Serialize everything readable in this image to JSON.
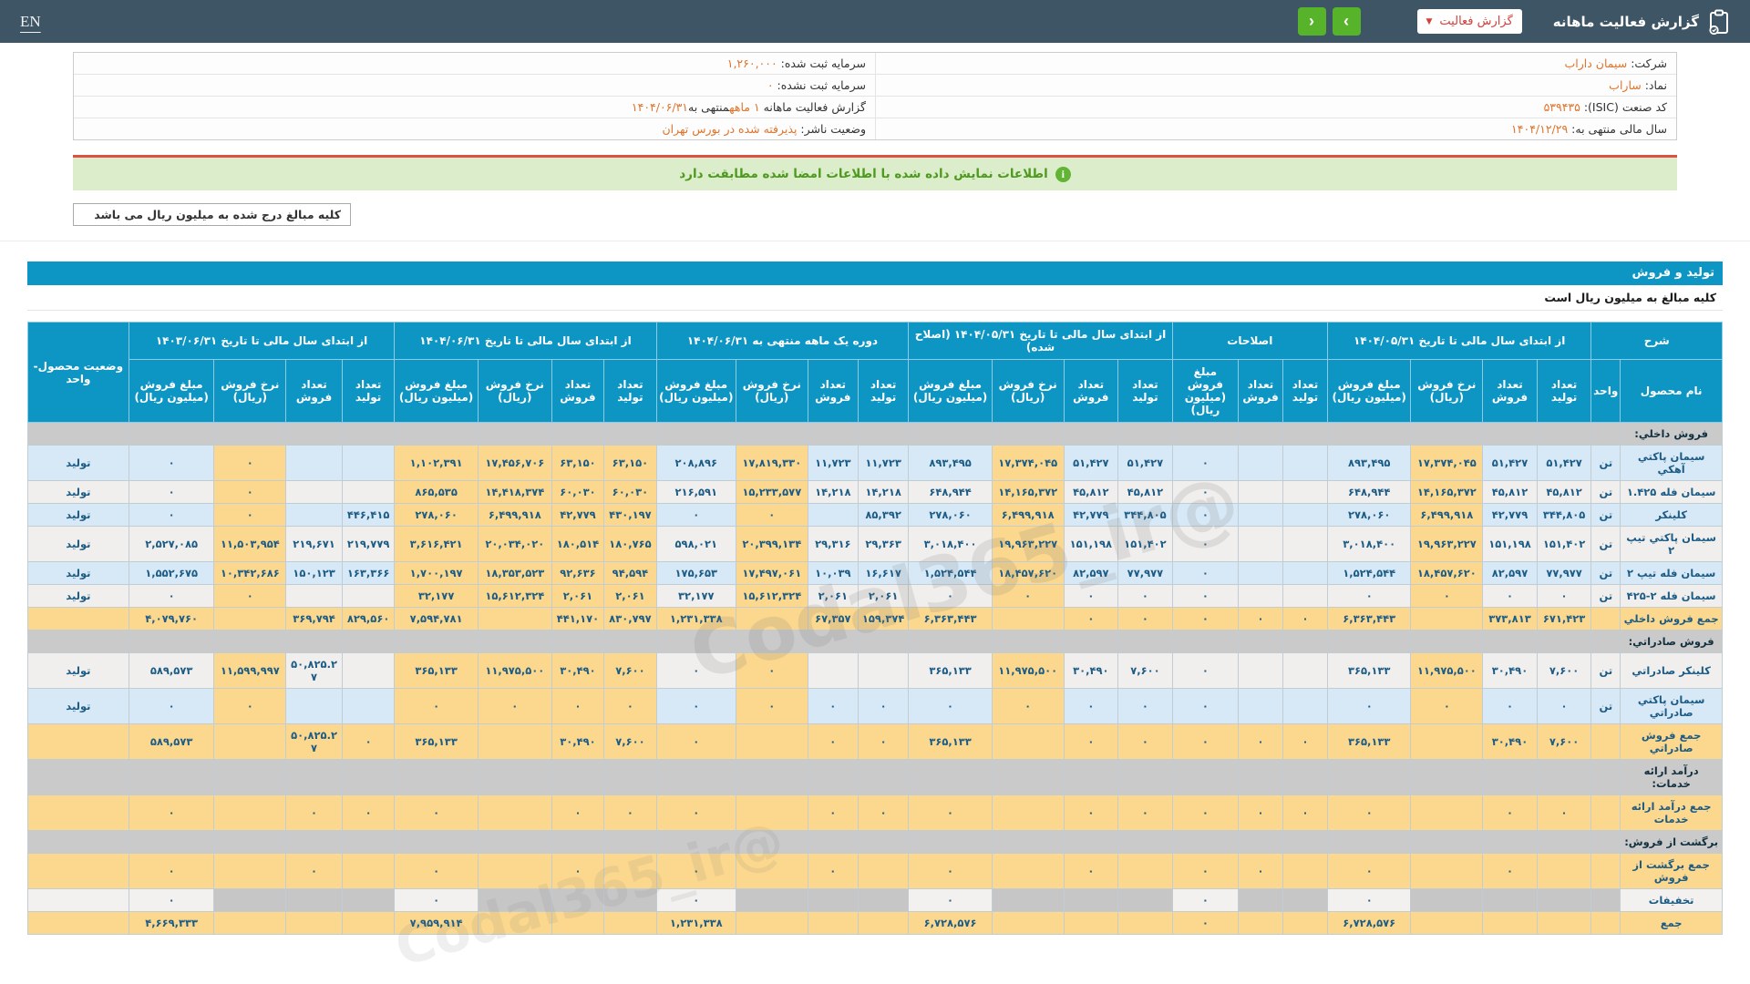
{
  "topbar": {
    "title": "گزارش فعالیت ماهانه",
    "dropdown_label": "گزارش فعالیت",
    "dropdown_caret": "▼",
    "nav_forward_glyph": "›",
    "nav_back_glyph": "‹",
    "lang": "EN"
  },
  "colors": {
    "topbar_bg": "#3d5565",
    "accent_blue": "#0d95c4",
    "highlight_yellow": "#fbd88d",
    "row_blue": "#d7e9f6",
    "row_gray": "#f0efed",
    "section_gray": "#cacaca",
    "value_orange": "#e0742c",
    "green_button": "#57b42a",
    "notice_bg": "#dcedcb",
    "notice_text": "#4e9a1e",
    "red_divider": "#dd5144",
    "number_blue": "#1d5c86"
  },
  "info": {
    "rows": [
      {
        "right": {
          "label": "شرکت:",
          "parts": [
            [
              "سیمان داراب",
              true
            ]
          ]
        },
        "left": {
          "label": "سرمایه ثبت شده:",
          "parts": [
            [
              "۱,۲۶۰,۰۰۰",
              true
            ]
          ]
        }
      },
      {
        "right": {
          "label": "نماد:",
          "parts": [
            [
              "ساراب",
              true
            ]
          ]
        },
        "left": {
          "label": "سرمایه ثبت نشده:",
          "parts": [
            [
              "۰",
              true
            ]
          ]
        }
      },
      {
        "right": {
          "label": "کد صنعت (ISIC):",
          "parts": [
            [
              "۵۳۹۴۳۵",
              true
            ]
          ]
        },
        "left": {
          "label": "گزارش فعالیت ماهانه",
          "parts": [
            [
              "۱ ماهه",
              true
            ],
            [
              "منتهی به",
              false
            ],
            [
              "۱۴۰۴/۰۶/۳۱",
              true
            ]
          ]
        }
      },
      {
        "right": {
          "label": "سال مالی منتهی به:",
          "parts": [
            [
              "۱۴۰۴/۱۲/۲۹",
              true
            ]
          ]
        },
        "left": {
          "label": "وضعیت ناشر:",
          "parts": [
            [
              "پذیرفته شده در بورس تهران",
              true
            ]
          ]
        }
      }
    ]
  },
  "notice": {
    "icon_glyph": "i",
    "text": "اطلاعات نمایش داده شده با اطلاعات امضا شده مطابقت دارد"
  },
  "amounts_box": {
    "text": "کلیه مبالغ درج شده به میلیون ریال می باشد"
  },
  "section_bar": {
    "title": "تولید و فروش"
  },
  "table_note": {
    "text": "کلیه مبالغ به میلیون ریال است"
  },
  "watermark": {
    "text": "@Codal365_ir"
  },
  "table": {
    "desc_header": "شرح",
    "name_header": "نام محصول",
    "unit_header": "واحد",
    "status_header": "وضعیت محصول-واحد",
    "subcols4": [
      "تعداد تولید",
      "تعداد فروش",
      "نرخ فروش (ریال)",
      "مبلغ فروش (میلیون ریال)"
    ],
    "subcols3": [
      "تعداد تولید",
      "تعداد فروش",
      "مبلغ فروش (میلیون ریال)"
    ],
    "groups": [
      {
        "key": "A",
        "label": "از ابتدای سال مالی تا تاریخ ۱۴۰۴/۰۵/۳۱",
        "cols": 4
      },
      {
        "key": "B",
        "label": "اصلاحات",
        "cols": 3
      },
      {
        "key": "C",
        "label": "از ابتدای سال مالی تا تاریخ ۱۴۰۴/۰۵/۳۱ (اصلاح شده)",
        "cols": 4
      },
      {
        "key": "D",
        "label": "دوره یک ماهه منتهی به ۱۴۰۴/۰۶/۳۱",
        "cols": 4
      },
      {
        "key": "E",
        "label": "از ابتدای سال مالی تا تاریخ ۱۴۰۴/۰۶/۳۱",
        "cols": 4
      },
      {
        "key": "F",
        "label": "از ابتدای سال مالی تا تاریخ ۱۴۰۳/۰۶/۳۱",
        "cols": 4
      }
    ],
    "rows": [
      {
        "type": "section",
        "name": "فروش داخلي:"
      },
      {
        "type": "data",
        "tone": "blue",
        "name": "سیمان پاکتي آهکي",
        "unit": "تن",
        "status": "تولید",
        "A": [
          "۵۱,۴۲۷",
          "۵۱,۴۲۷",
          "۱۷,۳۷۴,۰۴۵",
          "۸۹۳,۴۹۵"
        ],
        "B": [
          "",
          "",
          "۰"
        ],
        "C": [
          "۵۱,۴۲۷",
          "۵۱,۴۲۷",
          "۱۷,۳۷۴,۰۴۵",
          "۸۹۳,۴۹۵"
        ],
        "D": [
          "۱۱,۷۲۳",
          "۱۱,۷۲۳",
          "۱۷,۸۱۹,۳۳۰",
          "۲۰۸,۸۹۶"
        ],
        "E": [
          "۶۳,۱۵۰",
          "۶۳,۱۵۰",
          "۱۷,۴۵۶,۷۰۶",
          "۱,۱۰۲,۳۹۱"
        ],
        "F": [
          "",
          "",
          "۰",
          "۰"
        ]
      },
      {
        "type": "data",
        "tone": "gray",
        "name": "سیمان فله ۱.۴۲۵",
        "unit": "تن",
        "status": "تولید",
        "A": [
          "۴۵,۸۱۲",
          "۴۵,۸۱۲",
          "۱۴,۱۶۵,۳۷۲",
          "۶۴۸,۹۴۴"
        ],
        "B": [
          "",
          "",
          "۰"
        ],
        "C": [
          "۴۵,۸۱۲",
          "۴۵,۸۱۲",
          "۱۴,۱۶۵,۳۷۲",
          "۶۴۸,۹۴۴"
        ],
        "D": [
          "۱۴,۲۱۸",
          "۱۴,۲۱۸",
          "۱۵,۲۳۳,۵۷۷",
          "۲۱۶,۵۹۱"
        ],
        "E": [
          "۶۰,۰۳۰",
          "۶۰,۰۳۰",
          "۱۴,۴۱۸,۳۷۴",
          "۸۶۵,۵۳۵"
        ],
        "F": [
          "",
          "",
          "۰",
          "۰"
        ]
      },
      {
        "type": "data",
        "tone": "blue",
        "name": "کلینکر",
        "unit": "تن",
        "status": "تولید",
        "A": [
          "۳۴۴,۸۰۵",
          "۴۲,۷۷۹",
          "۶,۴۹۹,۹۱۸",
          "۲۷۸,۰۶۰"
        ],
        "B": [
          "",
          "",
          "۰"
        ],
        "C": [
          "۳۴۴,۸۰۵",
          "۴۲,۷۷۹",
          "۶,۴۹۹,۹۱۸",
          "۲۷۸,۰۶۰"
        ],
        "D": [
          "۸۵,۳۹۲",
          "",
          "۰",
          "۰"
        ],
        "E": [
          "۴۳۰,۱۹۷",
          "۴۲,۷۷۹",
          "۶,۴۹۹,۹۱۸",
          "۲۷۸,۰۶۰"
        ],
        "F": [
          "۴۴۶,۴۱۵",
          "",
          "۰",
          "۰"
        ]
      },
      {
        "type": "data",
        "tone": "gray",
        "name": "سیمان پاکتي تیپ ۲",
        "unit": "تن",
        "status": "تولید",
        "A": [
          "۱۵۱,۴۰۲",
          "۱۵۱,۱۹۸",
          "۱۹,۹۶۳,۲۲۷",
          "۳,۰۱۸,۴۰۰"
        ],
        "B": [
          "",
          "",
          "۰"
        ],
        "C": [
          "۱۵۱,۴۰۲",
          "۱۵۱,۱۹۸",
          "۱۹,۹۶۳,۲۲۷",
          "۳,۰۱۸,۴۰۰"
        ],
        "D": [
          "۲۹,۳۶۳",
          "۲۹,۳۱۶",
          "۲۰,۳۹۹,۱۳۴",
          "۵۹۸,۰۲۱"
        ],
        "E": [
          "۱۸۰,۷۶۵",
          "۱۸۰,۵۱۴",
          "۲۰,۰۳۴,۰۲۰",
          "۳,۶۱۶,۴۲۱"
        ],
        "F": [
          "۲۱۹,۷۷۹",
          "۲۱۹,۶۷۱",
          "۱۱,۵۰۳,۹۵۴",
          "۲,۵۲۷,۰۸۵"
        ]
      },
      {
        "type": "data",
        "tone": "blue",
        "name": "سیمان فله تیپ ۲",
        "unit": "تن",
        "status": "تولید",
        "A": [
          "۷۷,۹۷۷",
          "۸۲,۵۹۷",
          "۱۸,۴۵۷,۶۲۰",
          "۱,۵۲۴,۵۴۴"
        ],
        "B": [
          "",
          "",
          "۰"
        ],
        "C": [
          "۷۷,۹۷۷",
          "۸۲,۵۹۷",
          "۱۸,۴۵۷,۶۲۰",
          "۱,۵۲۴,۵۴۴"
        ],
        "D": [
          "۱۶,۶۱۷",
          "۱۰,۰۳۹",
          "۱۷,۴۹۷,۰۶۱",
          "۱۷۵,۶۵۳"
        ],
        "E": [
          "۹۴,۵۹۴",
          "۹۲,۶۳۶",
          "۱۸,۳۵۳,۵۲۳",
          "۱,۷۰۰,۱۹۷"
        ],
        "F": [
          "۱۶۳,۳۶۶",
          "۱۵۰,۱۲۳",
          "۱۰,۳۴۲,۶۸۶",
          "۱,۵۵۲,۶۷۵"
        ]
      },
      {
        "type": "data",
        "tone": "gray",
        "name": "سیمان فله ۲-۴۲۵",
        "unit": "تن",
        "status": "تولید",
        "A": [
          "۰",
          "۰",
          "۰",
          "۰"
        ],
        "B": [
          "",
          "",
          "۰"
        ],
        "C": [
          "۰",
          "۰",
          "۰",
          "۰"
        ],
        "D": [
          "۲,۰۶۱",
          "۲,۰۶۱",
          "۱۵,۶۱۲,۳۲۴",
          "۳۲,۱۷۷"
        ],
        "E": [
          "۲,۰۶۱",
          "۲,۰۶۱",
          "۱۵,۶۱۲,۳۲۴",
          "۳۲,۱۷۷"
        ],
        "F": [
          "",
          "",
          "۰",
          "۰"
        ]
      },
      {
        "type": "total",
        "name": "جمع فروش داخلي",
        "A": [
          "۶۷۱,۴۲۳",
          "۳۷۳,۸۱۳",
          "",
          "۶,۳۶۳,۴۴۳"
        ],
        "B": [
          "۰",
          "۰",
          "۰"
        ],
        "C": [
          "۰",
          "۰",
          "",
          "۶,۳۶۳,۴۴۳"
        ],
        "D": [
          "۱۵۹,۳۷۴",
          "۶۷,۳۵۷",
          "",
          "۱,۲۳۱,۳۳۸"
        ],
        "E": [
          "۸۳۰,۷۹۷",
          "۴۴۱,۱۷۰",
          "",
          "۷,۵۹۴,۷۸۱"
        ],
        "F": [
          "۸۲۹,۵۶۰",
          "۳۶۹,۷۹۴",
          "",
          "۴,۰۷۹,۷۶۰"
        ]
      },
      {
        "type": "section",
        "name": "فروش صادراتي:"
      },
      {
        "type": "data",
        "tone": "gray",
        "name": "کلینکر صادراتي",
        "unit": "تن",
        "status": "تولید",
        "A": [
          "۷,۶۰۰",
          "۳۰,۴۹۰",
          "۱۱,۹۷۵,۵۰۰",
          "۳۶۵,۱۳۳"
        ],
        "B": [
          "",
          "",
          "۰"
        ],
        "C": [
          "۷,۶۰۰",
          "۳۰,۴۹۰",
          "۱۱,۹۷۵,۵۰۰",
          "۳۶۵,۱۳۳"
        ],
        "D": [
          "",
          "",
          "۰",
          "۰"
        ],
        "E": [
          "۷,۶۰۰",
          "۳۰,۴۹۰",
          "۱۱,۹۷۵,۵۰۰",
          "۳۶۵,۱۳۳"
        ],
        "F": [
          "",
          "۵۰,۸۲۵.۲۷",
          "۱۱,۵۹۹,۹۹۷",
          "۵۸۹,۵۷۳"
        ]
      },
      {
        "type": "data",
        "tone": "blue",
        "name": "سیمان پاکتي صادراتي",
        "unit": "تن",
        "status": "تولید",
        "A": [
          "۰",
          "۰",
          "۰",
          "۰"
        ],
        "B": [
          "",
          "",
          "۰"
        ],
        "C": [
          "۰",
          "۰",
          "۰",
          "۰"
        ],
        "D": [
          "۰",
          "۰",
          "۰",
          "۰"
        ],
        "E": [
          "۰",
          "۰",
          "۰",
          "۰"
        ],
        "F": [
          "",
          "",
          "۰",
          "۰"
        ]
      },
      {
        "type": "total",
        "name": "جمع فروش صادراتي",
        "A": [
          "۷,۶۰۰",
          "۳۰,۴۹۰",
          "",
          "۳۶۵,۱۳۳"
        ],
        "B": [
          "۰",
          "۰",
          "۰"
        ],
        "C": [
          "۰",
          "۰",
          "",
          "۳۶۵,۱۳۳"
        ],
        "D": [
          "۰",
          "۰",
          "",
          "۰"
        ],
        "E": [
          "۷,۶۰۰",
          "۳۰,۴۹۰",
          "",
          "۳۶۵,۱۳۳"
        ],
        "F": [
          "۰",
          "۵۰,۸۲۵.۲۷",
          "",
          "۵۸۹,۵۷۳"
        ]
      },
      {
        "type": "section",
        "name": "درآمد ارائه خدمات:"
      },
      {
        "type": "total",
        "name": "جمع درآمد ارائه خدمات",
        "A": [
          "۰",
          "۰",
          "",
          "۰"
        ],
        "B": [
          "۰",
          "۰",
          "۰"
        ],
        "C": [
          "۰",
          "۰",
          "",
          "۰"
        ],
        "D": [
          "۰",
          "۰",
          "",
          "۰"
        ],
        "E": [
          "۰",
          "۰",
          "",
          "۰"
        ],
        "F": [
          "۰",
          "۰",
          "",
          "۰"
        ]
      },
      {
        "type": "section",
        "name": "برگشت از فروش:"
      },
      {
        "type": "total",
        "name": "جمع برگشت از فروش",
        "A": [
          "",
          "۰",
          "",
          "۰"
        ],
        "B": [
          "",
          "۰",
          "۰"
        ],
        "C": [
          "",
          "۰",
          "",
          "۰"
        ],
        "D": [
          "",
          "۰",
          "",
          "۰"
        ],
        "E": [
          "",
          "۰",
          "",
          "۰"
        ],
        "F": [
          "",
          "۰",
          "",
          "۰"
        ]
      },
      {
        "type": "discount",
        "name": "تخفیفات",
        "A": [
          "",
          "",
          "",
          "۰"
        ],
        "B": [
          "",
          "",
          "۰"
        ],
        "C": [
          "",
          "",
          "",
          "۰"
        ],
        "D": [
          "",
          "",
          "",
          "۰"
        ],
        "E": [
          "",
          "",
          "",
          "۰"
        ],
        "F": [
          "",
          "",
          "",
          "۰"
        ]
      },
      {
        "type": "total",
        "name": "جمع",
        "A": [
          "",
          "",
          "",
          "۶,۷۲۸,۵۷۶"
        ],
        "B": [
          "",
          "",
          "۰"
        ],
        "C": [
          "",
          "",
          "",
          "۶,۷۲۸,۵۷۶"
        ],
        "D": [
          "",
          "",
          "",
          "۱,۲۳۱,۳۳۸"
        ],
        "E": [
          "",
          "",
          "",
          "۷,۹۵۹,۹۱۴"
        ],
        "F": [
          "",
          "",
          "",
          "۴,۶۶۹,۳۳۳"
        ]
      }
    ]
  }
}
